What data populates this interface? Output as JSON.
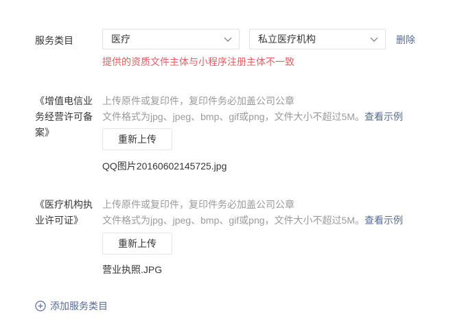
{
  "service_category": {
    "label": "服务类目",
    "primary_select": {
      "value": "医疗"
    },
    "secondary_select": {
      "value": "私立医疗机构"
    },
    "delete_label": "删除",
    "error_text": "提供的资质文件主体与小程序注册主体不一致"
  },
  "qualifications": [
    {
      "title_lines": [
        "《增值电信业",
        "务经营许可备",
        "案》"
      ],
      "hint_line1": "上传原件或复印件，复印件务必加盖公司公章",
      "hint_line2": "文件格式为jpg、jpeg、bmp、gif或png，文件大小不超过5M。",
      "example_link": "查看示例",
      "reupload_label": "重新上传",
      "file_name": "QQ图片20160602145725.jpg"
    },
    {
      "title_lines": [
        "《医疗机构执",
        "业许可证》"
      ],
      "hint_line1": "上传原件或复印件，复印件务必加盖公司公章",
      "hint_line2": "文件格式为jpg、jpeg、bmp、gif或png，文件大小不超过5M。",
      "example_link": "查看示例",
      "reupload_label": "重新上传",
      "file_name": "营业执照.JPG"
    }
  ],
  "add_category": {
    "icon": "plus-circle-icon",
    "label": "添加服务类目"
  },
  "colors": {
    "link": "#576b95",
    "error": "#e15f63",
    "hint": "#9a9a9a",
    "text": "#353535"
  }
}
